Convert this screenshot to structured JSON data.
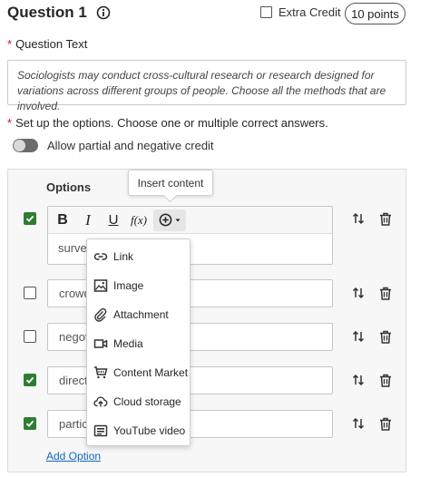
{
  "header": {
    "question_title": "Question 1",
    "extra_credit_label": "Extra Credit",
    "points_label": "10 points"
  },
  "question_text": {
    "label": "Question Text",
    "value": "Sociologists may conduct cross-cultural research or research designed for variations across different groups of people. Choose all the methods that are involved."
  },
  "setup": {
    "label": "Set up the options. Choose one or multiple correct answers.",
    "partial_credit_label": "Allow partial and negative credit",
    "partial_credit_on": false
  },
  "options": {
    "header": "Options",
    "items": [
      {
        "text": "survey",
        "correct": true
      },
      {
        "text": "crowd",
        "correct": false
      },
      {
        "text": "negoti",
        "correct": false
      },
      {
        "text": "direct",
        "correct": true
      },
      {
        "text": "partic",
        "correct": true
      }
    ],
    "add_option_label": "Add Option"
  },
  "toolbar": {
    "bold": "B",
    "italic": "I",
    "underline": "U",
    "math": "f(x)",
    "insert_tooltip": "Insert content"
  },
  "insert_menu": {
    "items": [
      {
        "label": "Link",
        "icon": "link-icon"
      },
      {
        "label": "Image",
        "icon": "image-icon"
      },
      {
        "label": "Attachment",
        "icon": "paperclip-icon"
      },
      {
        "label": "Media",
        "icon": "video-camera-icon"
      },
      {
        "label": "Content Market",
        "icon": "cart-icon"
      },
      {
        "label": "Cloud storage",
        "icon": "cloud-upload-icon"
      },
      {
        "label": "YouTube video",
        "icon": "youtube-icon"
      }
    ]
  },
  "colors": {
    "accent_green": "#2e7d32",
    "link_blue": "#1565c0",
    "required_red": "#c8102e"
  }
}
